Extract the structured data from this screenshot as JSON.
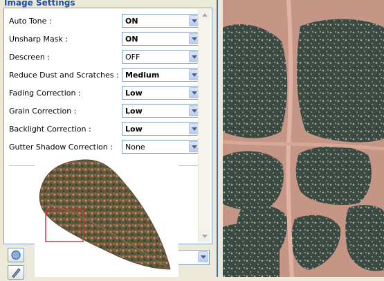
{
  "panel": {
    "title": "Image Settings"
  },
  "settings": [
    {
      "label": "Auto Tone :",
      "value": "ON"
    },
    {
      "label": "Unsharp Mask :",
      "value": "ON"
    },
    {
      "label": "Descreen :",
      "value": "OFF"
    },
    {
      "label": "Reduce Dust and Scratches :",
      "value": "Medium"
    },
    {
      "label": "Fading Correction :",
      "value": "Low"
    },
    {
      "label": "Grain Correction :",
      "value": "Low"
    },
    {
      "label": "Backlight Correction :",
      "value": "Low"
    },
    {
      "label": "Gutter Shadow Correction :",
      "value": "None"
    }
  ],
  "icons": {
    "dropdown": "chevron-down-icon",
    "preview_tool": "circle-icon",
    "edit_tool": "edit-icon",
    "scroll_up": "scroll-up-icon",
    "scroll_down": "scroll-down-icon"
  },
  "colors": {
    "title": "#1d4fa6",
    "selection_rect": "#d03a3a",
    "frame_edge": "#3a6ad4"
  }
}
